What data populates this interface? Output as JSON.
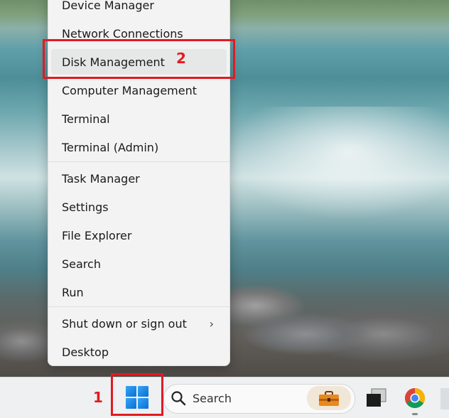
{
  "menu": {
    "items": [
      {
        "label": "Device Manager"
      },
      {
        "label": "Network Connections"
      },
      {
        "label": "Disk Management"
      },
      {
        "label": "Computer Management"
      },
      {
        "label": "Terminal"
      },
      {
        "label": "Terminal (Admin)"
      },
      {
        "label": "Task Manager"
      },
      {
        "label": "Settings"
      },
      {
        "label": "File Explorer"
      },
      {
        "label": "Search"
      },
      {
        "label": "Run"
      },
      {
        "label": "Shut down or sign out",
        "submenu_glyph": "›"
      },
      {
        "label": "Desktop"
      }
    ],
    "highlighted_index": 2
  },
  "annotations": {
    "step1": "1",
    "step2": "2",
    "color": "#e11b22"
  },
  "taskbar": {
    "search_label": "Search",
    "icons": [
      "windows-start-icon",
      "search-icon",
      "briefcase-icon",
      "task-view-icon",
      "chrome-icon"
    ]
  }
}
